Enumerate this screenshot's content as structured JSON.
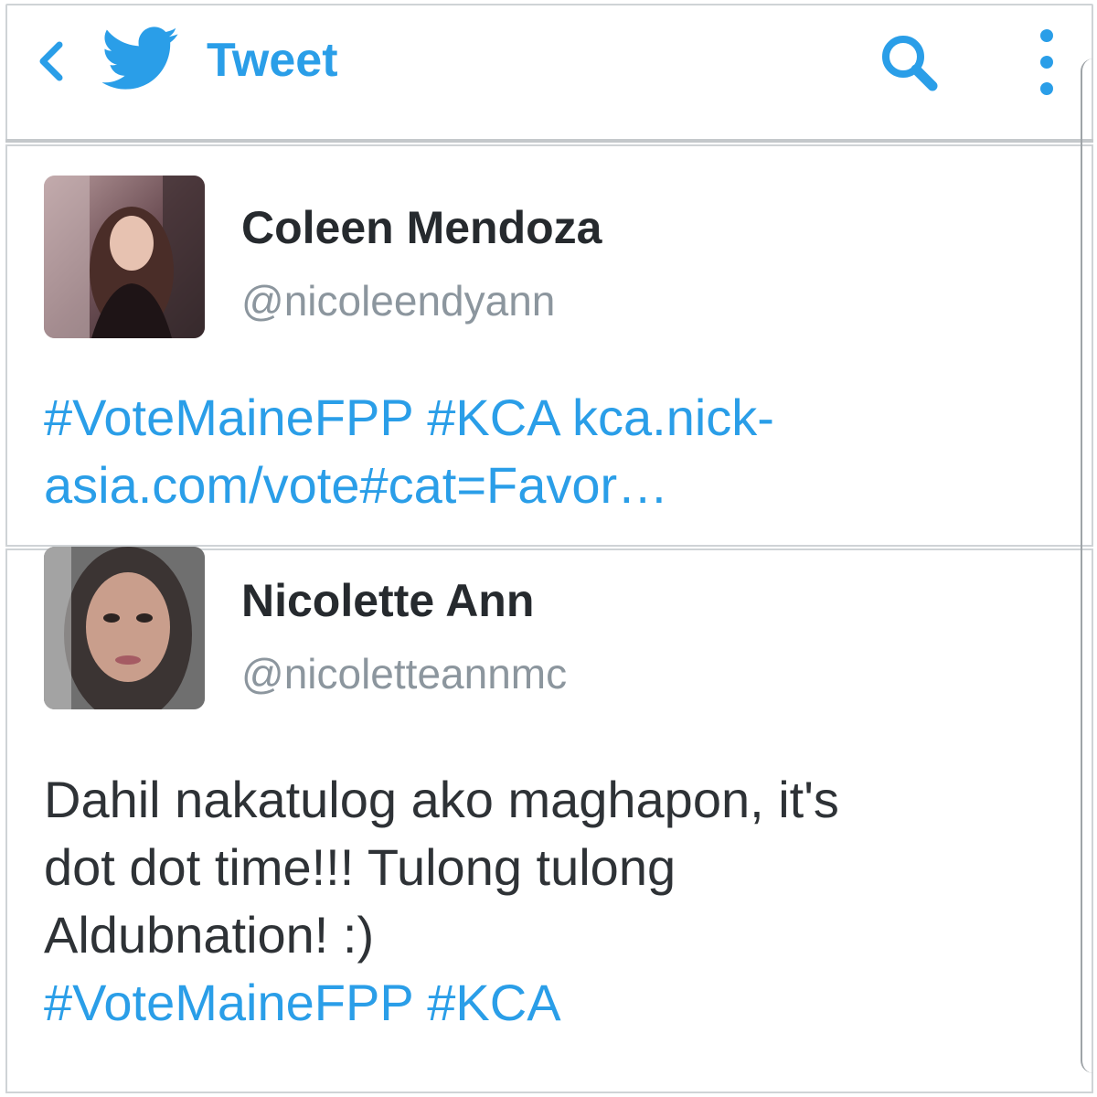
{
  "header": {
    "title": "Tweet",
    "back_icon": "chevron-left-icon",
    "logo_icon": "twitter-bird-icon",
    "search_icon": "search-icon",
    "more_icon": "more-vertical-icon"
  },
  "colors": {
    "accent": "#2a9ee8",
    "text": "#262a2e",
    "muted": "#8c969e",
    "border": "#cfd3d6"
  },
  "tweets": [
    {
      "display_name": "Coleen Mendoza",
      "handle": "@nicoleendyann",
      "hashtag_1": "#VoteMaineFPP",
      "hashtag_2": "#KCA",
      "link_line_1": "kca.nick-",
      "link_line_2": "asia.com/vote#cat=Favor…"
    },
    {
      "display_name": "Nicolette Ann",
      "handle": "@nicoletteannmc",
      "text_line_1": "Dahil nakatulog ako maghapon, it's",
      "text_line_2": "dot dot time!!! Tulong tulong",
      "text_line_3": "Aldubnation! :)",
      "hashtag_1": "#VoteMaineFPP",
      "hashtag_2": "#KCA"
    }
  ]
}
